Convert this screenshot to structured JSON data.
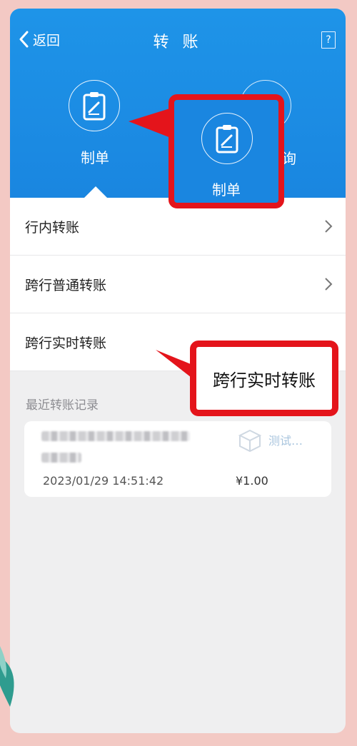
{
  "header": {
    "back_label": "返回",
    "title": "转 账"
  },
  "tabs": {
    "main_label": "制单",
    "ghost_partial_label": "询"
  },
  "menu": [
    {
      "label": "行内转账"
    },
    {
      "label": "跨行普通转账"
    },
    {
      "label": "跨行实时转账"
    }
  ],
  "recent": {
    "section_title": "最近转账记录",
    "record": {
      "name": "测试…",
      "datetime": "2023/01/29  14:51:42",
      "amount": "¥1.00"
    }
  },
  "annotations": {
    "callout_tab_label": "制单",
    "callout_text": "跨行实时转账"
  },
  "colors": {
    "header_blue": "#1a86e0",
    "highlight_red": "#e4141b",
    "background": "#efeff0"
  },
  "icons": [
    "back-chevron-icon",
    "help-icon",
    "clipboard-edit-icon",
    "chevron-right-icon",
    "package-box-icon"
  ]
}
